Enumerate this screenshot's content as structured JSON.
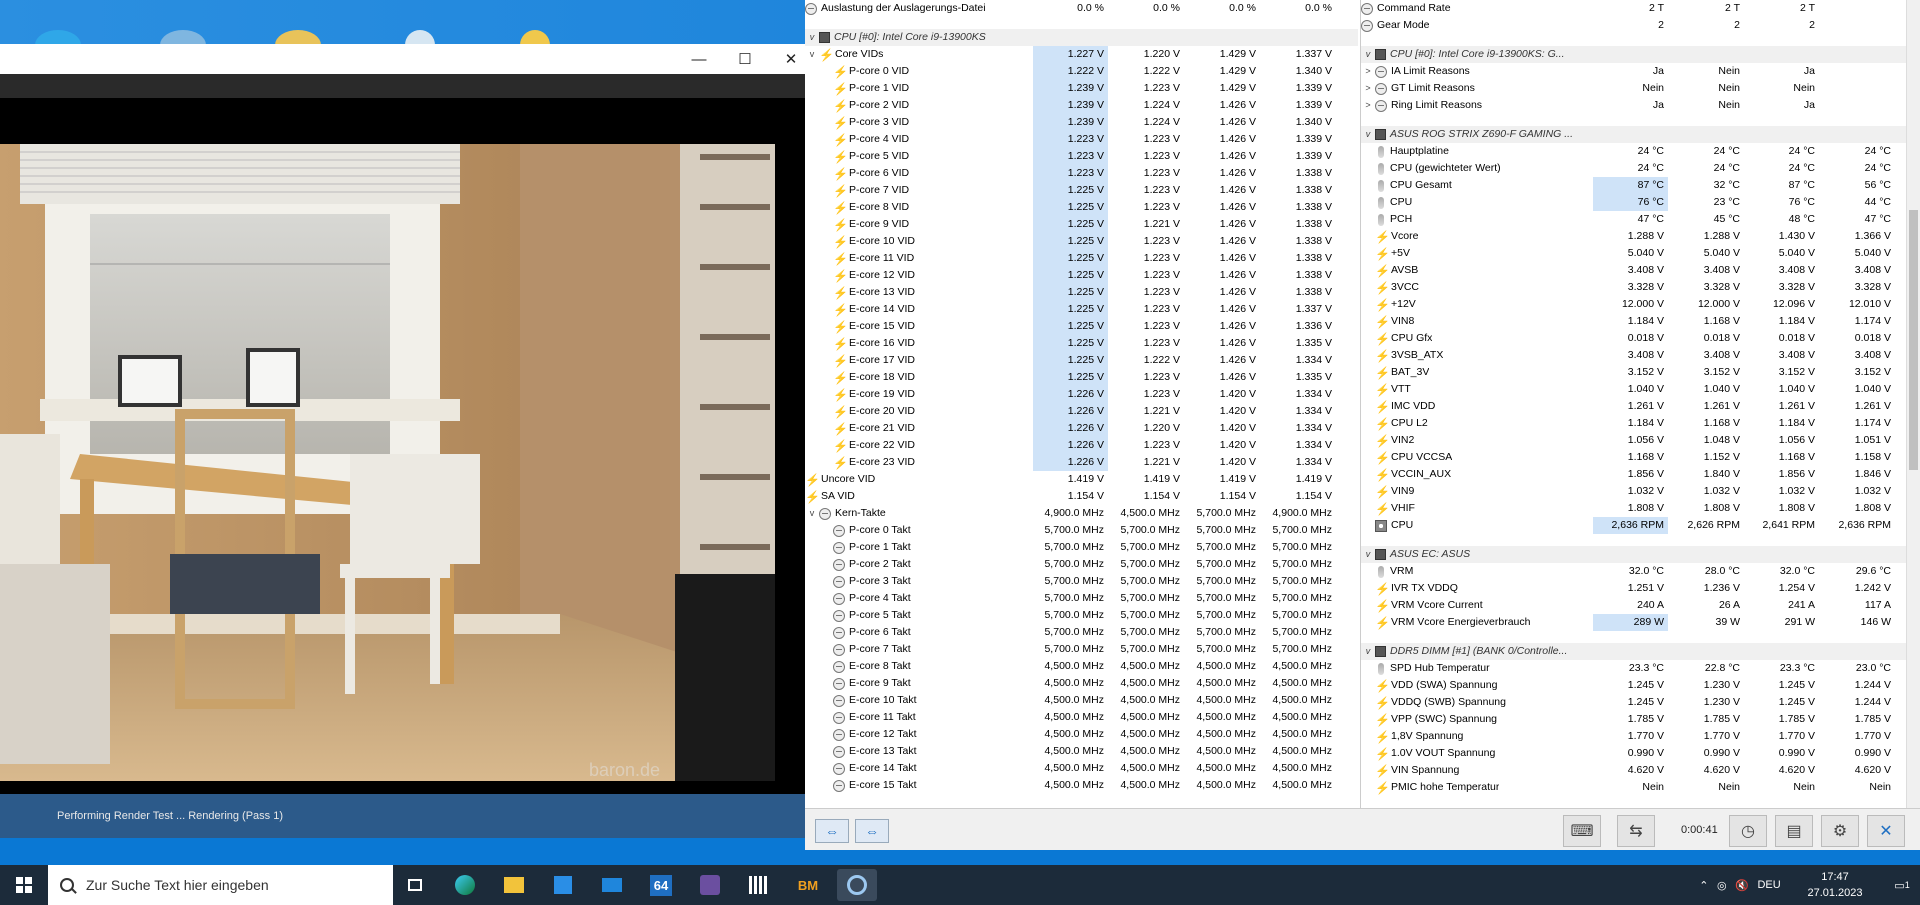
{
  "render": {
    "minimize": "—",
    "maximize": "☐",
    "close": "✕",
    "watermark": "baron.de",
    "status": "Performing Render Test ... Rendering (Pass 1)"
  },
  "hwinfo_left": [
    {
      "type": "row",
      "depth": 0,
      "icon": "clock",
      "label": "Auslastung der Auslagerungs-Datei",
      "v": [
        "0.0 %",
        "0.0 %",
        "0.0 %",
        "0.0 %"
      ]
    },
    {
      "type": "blank"
    },
    {
      "type": "hdr",
      "label": "CPU [#0]: Intel Core i9-13900KS"
    },
    {
      "type": "row",
      "depth": 1,
      "expand": "v",
      "icon": "volt",
      "label": "Core VIDs",
      "v": [
        "1.227 V",
        "1.220 V",
        "1.429 V",
        "1.337 V"
      ],
      "hl": true
    },
    {
      "type": "row",
      "depth": 2,
      "icon": "volt",
      "label": "P-core 0 VID",
      "v": [
        "1.222 V",
        "1.222 V",
        "1.429 V",
        "1.340 V"
      ],
      "hl": true
    },
    {
      "type": "row",
      "depth": 2,
      "icon": "volt",
      "label": "P-core 1 VID",
      "v": [
        "1.239 V",
        "1.223 V",
        "1.429 V",
        "1.339 V"
      ],
      "hl": true
    },
    {
      "type": "row",
      "depth": 2,
      "icon": "volt",
      "label": "P-core 2 VID",
      "v": [
        "1.239 V",
        "1.224 V",
        "1.426 V",
        "1.339 V"
      ],
      "hl": true
    },
    {
      "type": "row",
      "depth": 2,
      "icon": "volt",
      "label": "P-core 3 VID",
      "v": [
        "1.239 V",
        "1.224 V",
        "1.426 V",
        "1.340 V"
      ],
      "hl": true
    },
    {
      "type": "row",
      "depth": 2,
      "icon": "volt",
      "label": "P-core 4 VID",
      "v": [
        "1.223 V",
        "1.223 V",
        "1.426 V",
        "1.339 V"
      ],
      "hl": true
    },
    {
      "type": "row",
      "depth": 2,
      "icon": "volt",
      "label": "P-core 5 VID",
      "v": [
        "1.223 V",
        "1.223 V",
        "1.426 V",
        "1.339 V"
      ],
      "hl": true
    },
    {
      "type": "row",
      "depth": 2,
      "icon": "volt",
      "label": "P-core 6 VID",
      "v": [
        "1.223 V",
        "1.223 V",
        "1.426 V",
        "1.338 V"
      ],
      "hl": true
    },
    {
      "type": "row",
      "depth": 2,
      "icon": "volt",
      "label": "P-core 7 VID",
      "v": [
        "1.225 V",
        "1.223 V",
        "1.426 V",
        "1.338 V"
      ],
      "hl": true
    },
    {
      "type": "row",
      "depth": 2,
      "icon": "volt",
      "label": "E-core 8 VID",
      "v": [
        "1.225 V",
        "1.223 V",
        "1.426 V",
        "1.338 V"
      ],
      "hl": true
    },
    {
      "type": "row",
      "depth": 2,
      "icon": "volt",
      "label": "E-core 9 VID",
      "v": [
        "1.225 V",
        "1.221 V",
        "1.426 V",
        "1.338 V"
      ],
      "hl": true
    },
    {
      "type": "row",
      "depth": 2,
      "icon": "volt",
      "label": "E-core 10 VID",
      "v": [
        "1.225 V",
        "1.223 V",
        "1.426 V",
        "1.338 V"
      ],
      "hl": true
    },
    {
      "type": "row",
      "depth": 2,
      "icon": "volt",
      "label": "E-core 11 VID",
      "v": [
        "1.225 V",
        "1.223 V",
        "1.426 V",
        "1.338 V"
      ],
      "hl": true
    },
    {
      "type": "row",
      "depth": 2,
      "icon": "volt",
      "label": "E-core 12 VID",
      "v": [
        "1.225 V",
        "1.223 V",
        "1.426 V",
        "1.338 V"
      ],
      "hl": true
    },
    {
      "type": "row",
      "depth": 2,
      "icon": "volt",
      "label": "E-core 13 VID",
      "v": [
        "1.225 V",
        "1.223 V",
        "1.426 V",
        "1.338 V"
      ],
      "hl": true
    },
    {
      "type": "row",
      "depth": 2,
      "icon": "volt",
      "label": "E-core 14 VID",
      "v": [
        "1.225 V",
        "1.223 V",
        "1.426 V",
        "1.337 V"
      ],
      "hl": true
    },
    {
      "type": "row",
      "depth": 2,
      "icon": "volt",
      "label": "E-core 15 VID",
      "v": [
        "1.225 V",
        "1.223 V",
        "1.426 V",
        "1.336 V"
      ],
      "hl": true
    },
    {
      "type": "row",
      "depth": 2,
      "icon": "volt",
      "label": "E-core 16 VID",
      "v": [
        "1.225 V",
        "1.223 V",
        "1.426 V",
        "1.335 V"
      ],
      "hl": true
    },
    {
      "type": "row",
      "depth": 2,
      "icon": "volt",
      "label": "E-core 17 VID",
      "v": [
        "1.225 V",
        "1.222 V",
        "1.426 V",
        "1.334 V"
      ],
      "hl": true
    },
    {
      "type": "row",
      "depth": 2,
      "icon": "volt",
      "label": "E-core 18 VID",
      "v": [
        "1.225 V",
        "1.223 V",
        "1.426 V",
        "1.335 V"
      ],
      "hl": true
    },
    {
      "type": "row",
      "depth": 2,
      "icon": "volt",
      "label": "E-core 19 VID",
      "v": [
        "1.226 V",
        "1.223 V",
        "1.420 V",
        "1.334 V"
      ],
      "hl": true
    },
    {
      "type": "row",
      "depth": 2,
      "icon": "volt",
      "label": "E-core 20 VID",
      "v": [
        "1.226 V",
        "1.221 V",
        "1.420 V",
        "1.334 V"
      ],
      "hl": true
    },
    {
      "type": "row",
      "depth": 2,
      "icon": "volt",
      "label": "E-core 21 VID",
      "v": [
        "1.226 V",
        "1.220 V",
        "1.420 V",
        "1.334 V"
      ],
      "hl": true
    },
    {
      "type": "row",
      "depth": 2,
      "icon": "volt",
      "label": "E-core 22 VID",
      "v": [
        "1.226 V",
        "1.223 V",
        "1.420 V",
        "1.334 V"
      ],
      "hl": true
    },
    {
      "type": "row",
      "depth": 2,
      "icon": "volt",
      "label": "E-core 23 VID",
      "v": [
        "1.226 V",
        "1.221 V",
        "1.420 V",
        "1.334 V"
      ],
      "hl": true
    },
    {
      "type": "row",
      "depth": 0,
      "icon": "volt",
      "label": "Uncore VID",
      "v": [
        "1.419 V",
        "1.419 V",
        "1.419 V",
        "1.419 V"
      ]
    },
    {
      "type": "row",
      "depth": 0,
      "icon": "volt",
      "label": "SA VID",
      "v": [
        "1.154 V",
        "1.154 V",
        "1.154 V",
        "1.154 V"
      ]
    },
    {
      "type": "row",
      "depth": 1,
      "expand": "v",
      "icon": "clock",
      "label": "Kern-Takte",
      "v": [
        "4,900.0 MHz",
        "4,500.0 MHz",
        "5,700.0 MHz",
        "4,900.0 MHz"
      ]
    },
    {
      "type": "row",
      "depth": 2,
      "icon": "clock",
      "label": "P-core 0 Takt",
      "v": [
        "5,700.0 MHz",
        "5,700.0 MHz",
        "5,700.0 MHz",
        "5,700.0 MHz"
      ]
    },
    {
      "type": "row",
      "depth": 2,
      "icon": "clock",
      "label": "P-core 1 Takt",
      "v": [
        "5,700.0 MHz",
        "5,700.0 MHz",
        "5,700.0 MHz",
        "5,700.0 MHz"
      ]
    },
    {
      "type": "row",
      "depth": 2,
      "icon": "clock",
      "label": "P-core 2 Takt",
      "v": [
        "5,700.0 MHz",
        "5,700.0 MHz",
        "5,700.0 MHz",
        "5,700.0 MHz"
      ]
    },
    {
      "type": "row",
      "depth": 2,
      "icon": "clock",
      "label": "P-core 3 Takt",
      "v": [
        "5,700.0 MHz",
        "5,700.0 MHz",
        "5,700.0 MHz",
        "5,700.0 MHz"
      ]
    },
    {
      "type": "row",
      "depth": 2,
      "icon": "clock",
      "label": "P-core 4 Takt",
      "v": [
        "5,700.0 MHz",
        "5,700.0 MHz",
        "5,700.0 MHz",
        "5,700.0 MHz"
      ]
    },
    {
      "type": "row",
      "depth": 2,
      "icon": "clock",
      "label": "P-core 5 Takt",
      "v": [
        "5,700.0 MHz",
        "5,700.0 MHz",
        "5,700.0 MHz",
        "5,700.0 MHz"
      ]
    },
    {
      "type": "row",
      "depth": 2,
      "icon": "clock",
      "label": "P-core 6 Takt",
      "v": [
        "5,700.0 MHz",
        "5,700.0 MHz",
        "5,700.0 MHz",
        "5,700.0 MHz"
      ]
    },
    {
      "type": "row",
      "depth": 2,
      "icon": "clock",
      "label": "P-core 7 Takt",
      "v": [
        "5,700.0 MHz",
        "5,700.0 MHz",
        "5,700.0 MHz",
        "5,700.0 MHz"
      ]
    },
    {
      "type": "row",
      "depth": 2,
      "icon": "clock",
      "label": "E-core 8 Takt",
      "v": [
        "4,500.0 MHz",
        "4,500.0 MHz",
        "4,500.0 MHz",
        "4,500.0 MHz"
      ]
    },
    {
      "type": "row",
      "depth": 2,
      "icon": "clock",
      "label": "E-core 9 Takt",
      "v": [
        "4,500.0 MHz",
        "4,500.0 MHz",
        "4,500.0 MHz",
        "4,500.0 MHz"
      ]
    },
    {
      "type": "row",
      "depth": 2,
      "icon": "clock",
      "label": "E-core 10 Takt",
      "v": [
        "4,500.0 MHz",
        "4,500.0 MHz",
        "4,500.0 MHz",
        "4,500.0 MHz"
      ]
    },
    {
      "type": "row",
      "depth": 2,
      "icon": "clock",
      "label": "E-core 11 Takt",
      "v": [
        "4,500.0 MHz",
        "4,500.0 MHz",
        "4,500.0 MHz",
        "4,500.0 MHz"
      ]
    },
    {
      "type": "row",
      "depth": 2,
      "icon": "clock",
      "label": "E-core 12 Takt",
      "v": [
        "4,500.0 MHz",
        "4,500.0 MHz",
        "4,500.0 MHz",
        "4,500.0 MHz"
      ]
    },
    {
      "type": "row",
      "depth": 2,
      "icon": "clock",
      "label": "E-core 13 Takt",
      "v": [
        "4,500.0 MHz",
        "4,500.0 MHz",
        "4,500.0 MHz",
        "4,500.0 MHz"
      ]
    },
    {
      "type": "row",
      "depth": 2,
      "icon": "clock",
      "label": "E-core 14 Takt",
      "v": [
        "4,500.0 MHz",
        "4,500.0 MHz",
        "4,500.0 MHz",
        "4,500.0 MHz"
      ]
    },
    {
      "type": "row",
      "depth": 2,
      "icon": "clock",
      "label": "E-core 15 Takt",
      "v": [
        "4,500.0 MHz",
        "4,500.0 MHz",
        "4,500.0 MHz",
        "4,500.0 MHz"
      ]
    }
  ],
  "hwinfo_right": [
    {
      "type": "row",
      "depth": 0,
      "icon": "clock",
      "label": "Command Rate",
      "v": [
        "2 T",
        "2 T",
        "2 T",
        ""
      ]
    },
    {
      "type": "row",
      "depth": 0,
      "icon": "clock",
      "label": "Gear Mode",
      "v": [
        "2",
        "2",
        "2",
        ""
      ]
    },
    {
      "type": "blank"
    },
    {
      "type": "hdr",
      "label": "CPU [#0]: Intel Core i9-13900KS: G..."
    },
    {
      "type": "row",
      "depth": 1,
      "expand": ">",
      "icon": "clock",
      "label": "IA Limit Reasons",
      "v": [
        "Ja",
        "Nein",
        "Ja",
        ""
      ]
    },
    {
      "type": "row",
      "depth": 1,
      "expand": ">",
      "icon": "clock",
      "label": "GT Limit Reasons",
      "v": [
        "Nein",
        "Nein",
        "Nein",
        ""
      ]
    },
    {
      "type": "row",
      "depth": 1,
      "expand": ">",
      "icon": "clock",
      "label": "Ring Limit Reasons",
      "v": [
        "Ja",
        "Nein",
        "Ja",
        ""
      ]
    },
    {
      "type": "blank"
    },
    {
      "type": "hdr",
      "label": "ASUS ROG STRIX Z690-F GAMING ..."
    },
    {
      "type": "row",
      "depth": 1,
      "icon": "therm",
      "label": "Hauptplatine",
      "v": [
        "24 °C",
        "24 °C",
        "24 °C",
        "24 °C"
      ]
    },
    {
      "type": "row",
      "depth": 1,
      "icon": "therm",
      "label": "CPU (gewichteter Wert)",
      "v": [
        "24 °C",
        "24 °C",
        "24 °C",
        "24 °C"
      ]
    },
    {
      "type": "row",
      "depth": 1,
      "icon": "therm",
      "label": "CPU Gesamt",
      "v": [
        "87 °C",
        "32 °C",
        "87 °C",
        "56 °C"
      ],
      "hl": true
    },
    {
      "type": "row",
      "depth": 1,
      "icon": "therm",
      "label": "CPU",
      "v": [
        "76 °C",
        "23 °C",
        "76 °C",
        "44 °C"
      ],
      "hl": true
    },
    {
      "type": "row",
      "depth": 1,
      "icon": "therm",
      "label": "PCH",
      "v": [
        "47 °C",
        "45 °C",
        "48 °C",
        "47 °C"
      ]
    },
    {
      "type": "row",
      "depth": 1,
      "icon": "volt",
      "label": "Vcore",
      "v": [
        "1.288 V",
        "1.288 V",
        "1.430 V",
        "1.366 V"
      ]
    },
    {
      "type": "row",
      "depth": 1,
      "icon": "volt",
      "label": "+5V",
      "v": [
        "5.040 V",
        "5.040 V",
        "5.040 V",
        "5.040 V"
      ]
    },
    {
      "type": "row",
      "depth": 1,
      "icon": "volt",
      "label": "AVSB",
      "v": [
        "3.408 V",
        "3.408 V",
        "3.408 V",
        "3.408 V"
      ]
    },
    {
      "type": "row",
      "depth": 1,
      "icon": "volt",
      "label": "3VCC",
      "v": [
        "3.328 V",
        "3.328 V",
        "3.328 V",
        "3.328 V"
      ]
    },
    {
      "type": "row",
      "depth": 1,
      "icon": "volt",
      "label": "+12V",
      "v": [
        "12.000 V",
        "12.000 V",
        "12.096 V",
        "12.010 V"
      ]
    },
    {
      "type": "row",
      "depth": 1,
      "icon": "volt",
      "label": "VIN8",
      "v": [
        "1.184 V",
        "1.168 V",
        "1.184 V",
        "1.174 V"
      ]
    },
    {
      "type": "row",
      "depth": 1,
      "icon": "volt",
      "label": "CPU Gfx",
      "v": [
        "0.018 V",
        "0.018 V",
        "0.018 V",
        "0.018 V"
      ]
    },
    {
      "type": "row",
      "depth": 1,
      "icon": "volt",
      "label": "3VSB_ATX",
      "v": [
        "3.408 V",
        "3.408 V",
        "3.408 V",
        "3.408 V"
      ]
    },
    {
      "type": "row",
      "depth": 1,
      "icon": "volt",
      "label": "BAT_3V",
      "v": [
        "3.152 V",
        "3.152 V",
        "3.152 V",
        "3.152 V"
      ]
    },
    {
      "type": "row",
      "depth": 1,
      "icon": "volt",
      "label": "VTT",
      "v": [
        "1.040 V",
        "1.040 V",
        "1.040 V",
        "1.040 V"
      ]
    },
    {
      "type": "row",
      "depth": 1,
      "icon": "volt",
      "label": "IMC VDD",
      "v": [
        "1.261 V",
        "1.261 V",
        "1.261 V",
        "1.261 V"
      ]
    },
    {
      "type": "row",
      "depth": 1,
      "icon": "volt",
      "label": "CPU L2",
      "v": [
        "1.184 V",
        "1.168 V",
        "1.184 V",
        "1.174 V"
      ]
    },
    {
      "type": "row",
      "depth": 1,
      "icon": "volt",
      "label": "VIN2",
      "v": [
        "1.056 V",
        "1.048 V",
        "1.056 V",
        "1.051 V"
      ]
    },
    {
      "type": "row",
      "depth": 1,
      "icon": "volt",
      "label": "CPU VCCSA",
      "v": [
        "1.168 V",
        "1.152 V",
        "1.168 V",
        "1.158 V"
      ]
    },
    {
      "type": "row",
      "depth": 1,
      "icon": "volt",
      "label": "VCCIN_AUX",
      "v": [
        "1.856 V",
        "1.840 V",
        "1.856 V",
        "1.846 V"
      ]
    },
    {
      "type": "row",
      "depth": 1,
      "icon": "volt",
      "label": "VIN9",
      "v": [
        "1.032 V",
        "1.032 V",
        "1.032 V",
        "1.032 V"
      ]
    },
    {
      "type": "row",
      "depth": 1,
      "icon": "volt",
      "label": "VHIF",
      "v": [
        "1.808 V",
        "1.808 V",
        "1.808 V",
        "1.808 V"
      ]
    },
    {
      "type": "row",
      "depth": 1,
      "icon": "fan",
      "label": "CPU",
      "v": [
        "2,636 RPM",
        "2,626 RPM",
        "2,641 RPM",
        "2,636 RPM"
      ],
      "hl": true
    },
    {
      "type": "blank"
    },
    {
      "type": "hdr",
      "label": "ASUS EC: ASUS"
    },
    {
      "type": "row",
      "depth": 1,
      "icon": "therm",
      "label": "VRM",
      "v": [
        "32.0 °C",
        "28.0 °C",
        "32.0 °C",
        "29.6 °C"
      ]
    },
    {
      "type": "row",
      "depth": 1,
      "icon": "volt",
      "label": "IVR TX VDDQ",
      "v": [
        "1.251 V",
        "1.236 V",
        "1.254 V",
        "1.242 V"
      ]
    },
    {
      "type": "row",
      "depth": 1,
      "icon": "volt",
      "label": "VRM Vcore Current",
      "v": [
        "240 A",
        "26 A",
        "241 A",
        "117 A"
      ]
    },
    {
      "type": "row",
      "depth": 1,
      "icon": "volt",
      "label": "VRM Vcore Energieverbrauch",
      "v": [
        "289 W",
        "39 W",
        "291 W",
        "146 W"
      ],
      "hl": true
    },
    {
      "type": "blank"
    },
    {
      "type": "hdr",
      "label": "DDR5 DIMM [#1] (BANK 0/Controlle..."
    },
    {
      "type": "row",
      "depth": 1,
      "icon": "therm",
      "label": "SPD Hub Temperatur",
      "v": [
        "23.3 °C",
        "22.8 °C",
        "23.3 °C",
        "23.0 °C"
      ]
    },
    {
      "type": "row",
      "depth": 1,
      "icon": "volt",
      "label": "VDD (SWA) Spannung",
      "v": [
        "1.245 V",
        "1.230 V",
        "1.245 V",
        "1.244 V"
      ]
    },
    {
      "type": "row",
      "depth": 1,
      "icon": "volt",
      "label": "VDDQ (SWB) Spannung",
      "v": [
        "1.245 V",
        "1.230 V",
        "1.245 V",
        "1.244 V"
      ]
    },
    {
      "type": "row",
      "depth": 1,
      "icon": "volt",
      "label": "VPP (SWC) Spannung",
      "v": [
        "1.785 V",
        "1.785 V",
        "1.785 V",
        "1.785 V"
      ]
    },
    {
      "type": "row",
      "depth": 1,
      "icon": "volt",
      "label": "1,8V Spannung",
      "v": [
        "1.770 V",
        "1.770 V",
        "1.770 V",
        "1.770 V"
      ]
    },
    {
      "type": "row",
      "depth": 1,
      "icon": "volt",
      "label": "1.0V VOUT Spannung",
      "v": [
        "0.990 V",
        "0.990 V",
        "0.990 V",
        "0.990 V"
      ]
    },
    {
      "type": "row",
      "depth": 1,
      "icon": "volt",
      "label": "VIN Spannung",
      "v": [
        "4.620 V",
        "4.620 V",
        "4.620 V",
        "4.620 V"
      ]
    },
    {
      "type": "row",
      "depth": 1,
      "icon": "volt",
      "label": "PMIC hohe Temperatur",
      "v": [
        "Nein",
        "Nein",
        "Nein",
        "Nein"
      ]
    }
  ],
  "hwinfo_bottom": {
    "timer": "0:00:41",
    "nav_left": "⇔",
    "nav_right": "⇔"
  },
  "taskbar": {
    "search_placeholder": "Zur Suche Text hier eingeben",
    "app_64_label": "64",
    "app_bm_label": "BM",
    "lang": "DEU",
    "time": "17:47",
    "date": "27.01.2023",
    "notif_count": "1"
  },
  "colors": {
    "highlight": "#cfe3f8",
    "desktop": "#0a78d4",
    "taskbar": "#1c2b3a"
  }
}
